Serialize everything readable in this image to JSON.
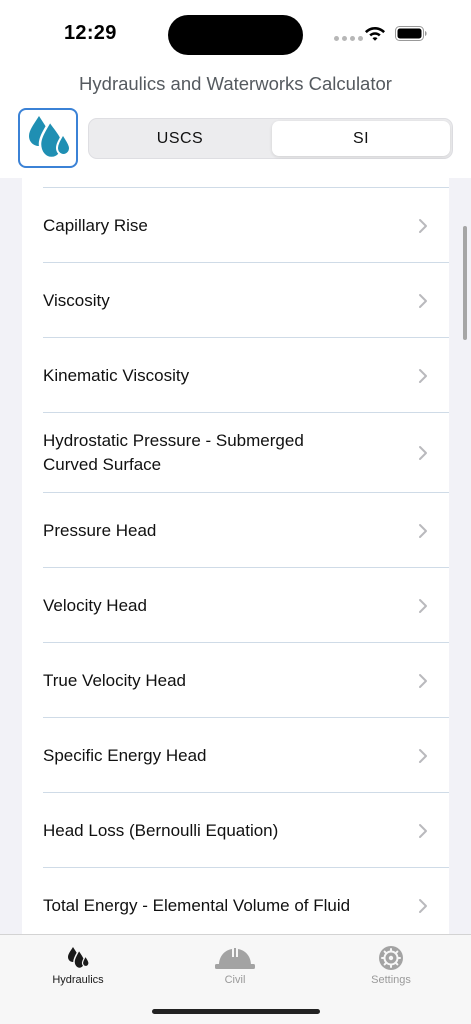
{
  "status_bar": {
    "time": "12:29"
  },
  "header": {
    "title": "Hydraulics and Waterworks Calculator",
    "logo_icon": "water-drops-icon"
  },
  "unit_toggle": {
    "options": [
      "USCS",
      "SI"
    ],
    "selected": "SI"
  },
  "list": {
    "items": [
      {
        "label": "Capillary Rise"
      },
      {
        "label": "Viscosity"
      },
      {
        "label": "Kinematic Viscosity"
      },
      {
        "label_line1": "Hydrostatic Pressure - Submerged",
        "label_line2": "Curved Surface"
      },
      {
        "label": "Pressure Head"
      },
      {
        "label": "Velocity Head"
      },
      {
        "label": "True Velocity Head"
      },
      {
        "label": "Specific Energy Head"
      },
      {
        "label": "Head Loss (Bernoulli Equation)"
      },
      {
        "label": "Total Energy - Elemental Volume of Fluid"
      }
    ],
    "chevron_icon": "chevron-right-icon"
  },
  "tab_bar": {
    "tabs": [
      {
        "label": "Hydraulics",
        "icon": "water-drops-icon",
        "active": true
      },
      {
        "label": "Civil",
        "icon": "hard-hat-icon",
        "active": false
      },
      {
        "label": "Settings",
        "icon": "gear-icon",
        "active": false
      }
    ]
  },
  "colors": {
    "accent_blue": "#1f8fb3",
    "logo_border": "#3b82d6",
    "separator": "#cfdbe7",
    "list_background": "#f2f2f7"
  }
}
